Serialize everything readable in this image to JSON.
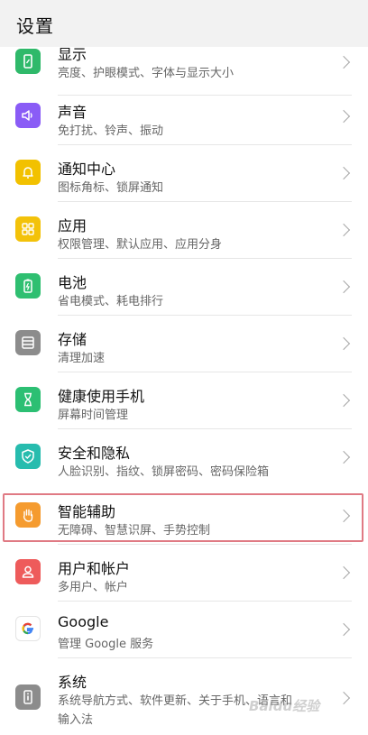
{
  "header": {
    "title": "设置"
  },
  "items": [
    {
      "label": "显示",
      "sub": "亮度、护眼模式、字体与显示大小",
      "icon": "display-icon",
      "color": "#2fb96a"
    },
    {
      "label": "声音",
      "sub": "免打扰、铃声、振动",
      "icon": "volume-icon",
      "color": "#8a5cf6"
    },
    {
      "label": "通知中心",
      "sub": "图标角标、锁屏通知",
      "icon": "bell-icon",
      "color": "#f2c100"
    },
    {
      "label": "应用",
      "sub": "权限管理、默认应用、应用分身",
      "icon": "apps-grid-icon",
      "color": "#f3c20a"
    },
    {
      "label": "电池",
      "sub": "省电模式、耗电排行",
      "icon": "battery-icon",
      "color": "#2fbf71"
    },
    {
      "label": "存储",
      "sub": "清理加速",
      "icon": "storage-icon",
      "color": "#8c8c8c"
    },
    {
      "label": "健康使用手机",
      "sub": "屏幕时间管理",
      "icon": "hourglass-icon",
      "color": "#2cbf73"
    },
    {
      "label": "安全和隐私",
      "sub": "人脸识别、指纹、锁屏密码、密码保险箱",
      "icon": "shield-check-icon",
      "color": "#27bcae"
    },
    {
      "label": "智能辅助",
      "sub": "无障碍、智慧识屏、手势控制",
      "icon": "hand-icon",
      "color": "#f59b2f"
    },
    {
      "label": "用户和帐户",
      "sub": "多用户、帐户",
      "icon": "user-icon",
      "color": "#ee5b5b"
    },
    {
      "label": "Google",
      "sub": "管理 Google 服务",
      "icon": "google-icon",
      "color": "#ffffff"
    },
    {
      "label": "系统",
      "sub": "系统导航方式、软件更新、关于手机、语言和",
      "sub2": "输入法",
      "icon": "phone-info-icon",
      "color": "#8c8c8c"
    }
  ],
  "watermark": "Baidu经验"
}
